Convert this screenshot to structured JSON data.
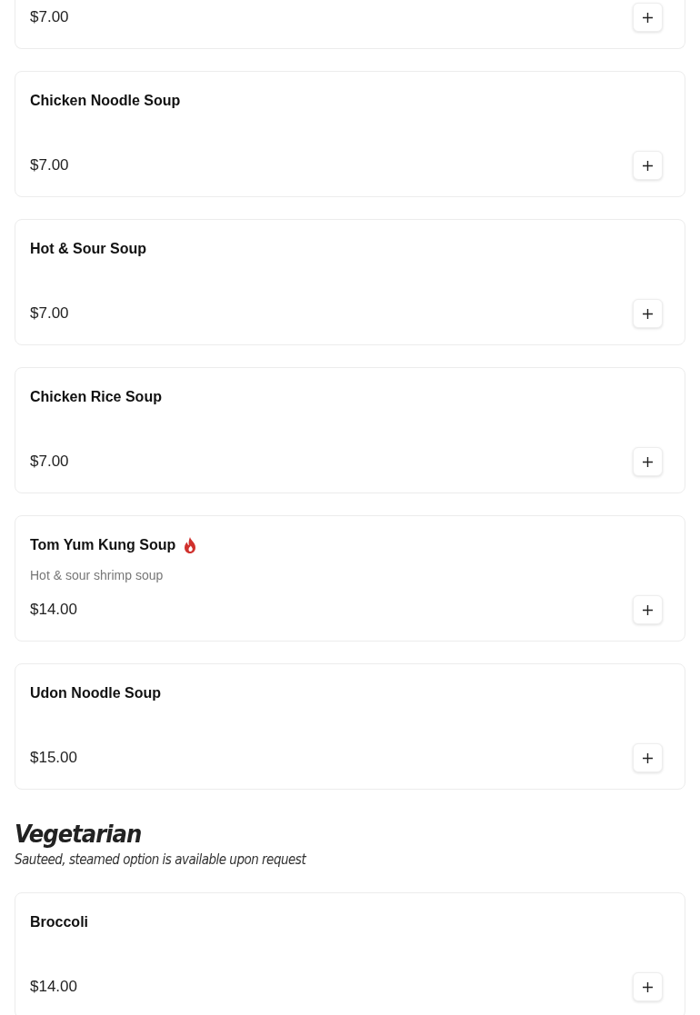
{
  "sections": [
    {
      "items": [
        {
          "price": "$7.00",
          "spicy": false
        },
        {
          "name": "Chicken Noodle Soup",
          "price": "$7.00",
          "spicy": false
        },
        {
          "name": "Hot & Sour Soup",
          "price": "$7.00",
          "spicy": false
        },
        {
          "name": "Chicken Rice Soup",
          "price": "$7.00",
          "spicy": false
        },
        {
          "name": "Tom Yum Kung Soup",
          "description": "Hot & sour shrimp soup",
          "price": "$14.00",
          "spicy": true
        },
        {
          "name": "Udon Noodle Soup",
          "price": "$15.00",
          "spicy": false
        }
      ]
    },
    {
      "title": "Vegetarian",
      "note": "Sauteed, steamed option is available upon request",
      "items": [
        {
          "name": "Broccoli",
          "price": "$14.00",
          "spicy": false
        }
      ]
    }
  ]
}
